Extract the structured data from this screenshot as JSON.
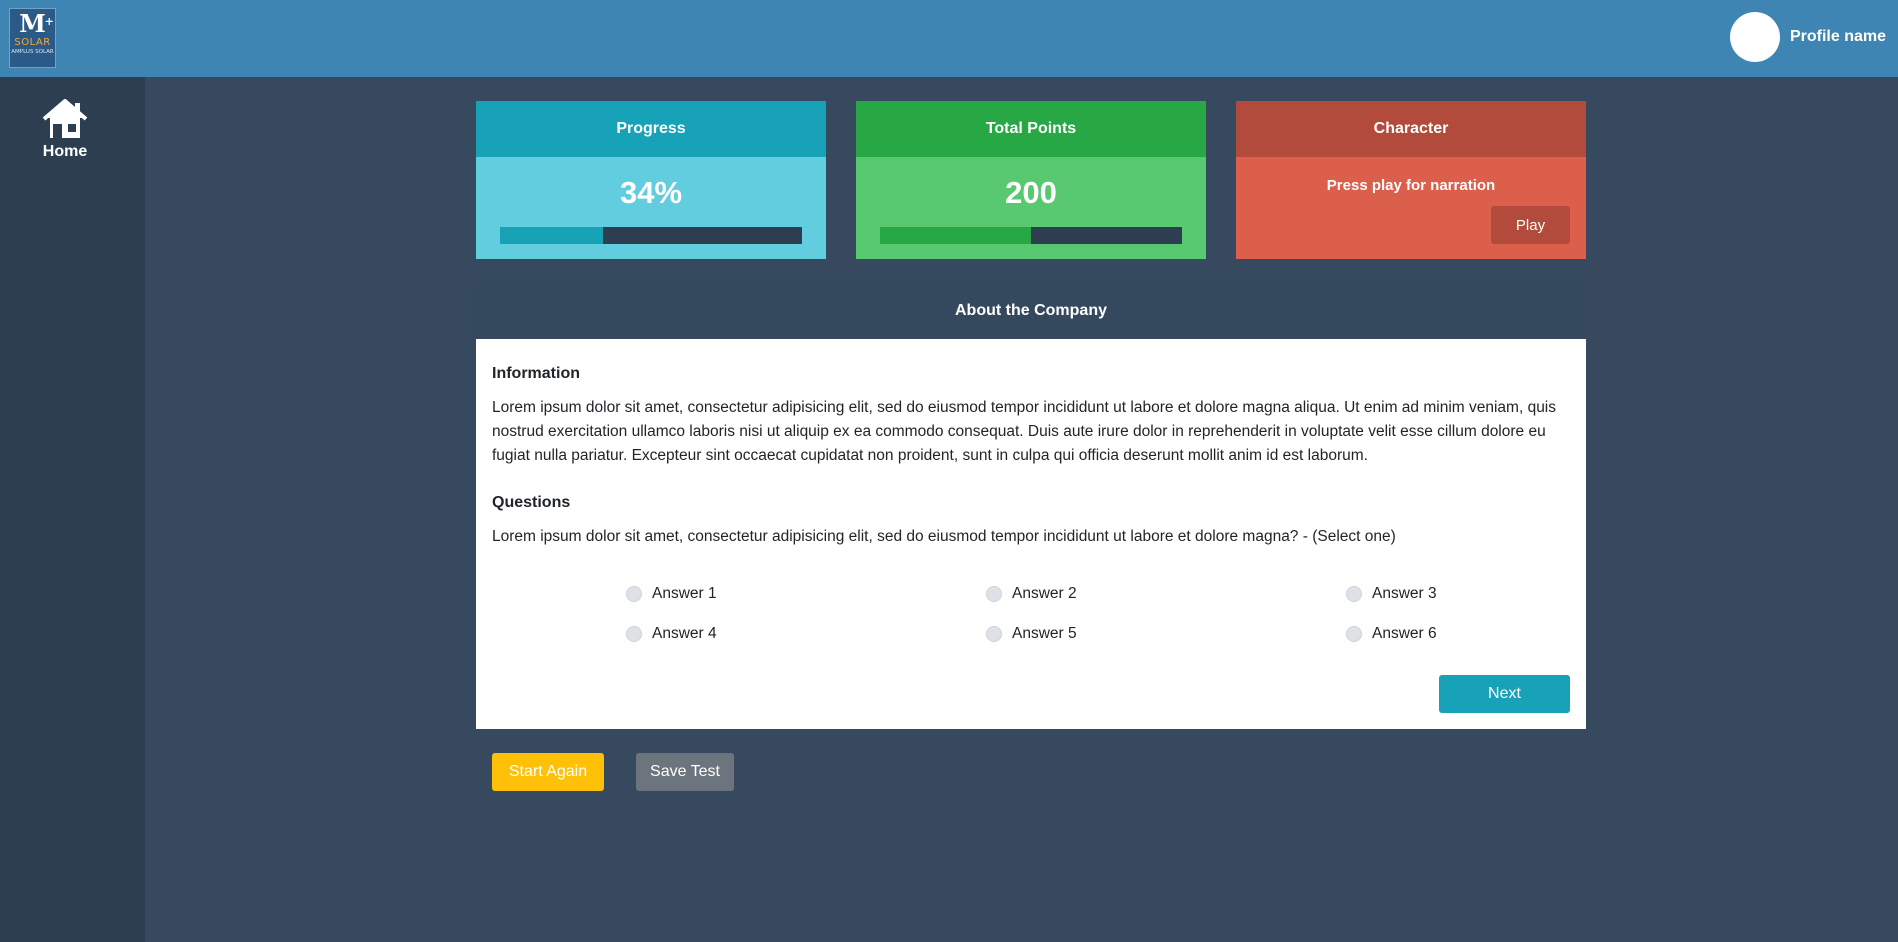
{
  "header": {
    "logo": {
      "mark": "M",
      "superscript": "+",
      "word": "SOLAR",
      "tagline": "AMPLUS SOLAR"
    },
    "profile_name": "Profile name"
  },
  "sidebar": {
    "items": [
      {
        "label": "Home",
        "icon": "home-icon"
      }
    ]
  },
  "cards": {
    "progress": {
      "title": "Progress",
      "value": "34%",
      "fraction": 0.34
    },
    "points": {
      "title": "Total Points",
      "value": "200",
      "fraction": 0.5
    },
    "character": {
      "title": "Character",
      "text": "Press play for narration",
      "play_label": "Play"
    }
  },
  "panel": {
    "title": "About the Company",
    "info_title": "Information",
    "info_text": "Lorem ipsum dolor sit amet, consectetur adipisicing elit, sed do eiusmod tempor incididunt ut labore et dolore magna aliqua. Ut enim ad minim veniam, quis nostrud exercitation ullamco laboris nisi ut aliquip ex ea commodo consequat. Duis aute irure dolor in reprehenderit in voluptate velit esse cillum dolore eu fugiat nulla pariatur. Excepteur sint occaecat cupidatat non proident, sunt in culpa qui officia deserunt mollit anim id est laborum.",
    "questions_title": "Questions",
    "question_text": "Lorem ipsum dolor sit amet, consectetur adipisicing elit, sed do eiusmod tempor incididunt ut labore et dolore magna? - (Select one)",
    "answers": [
      "Answer 1",
      "Answer 2",
      "Answer 3",
      "Answer 4",
      "Answer 5",
      "Answer 6"
    ],
    "next_label": "Next"
  },
  "actions": {
    "start_again_label": "Start Again",
    "save_test_label": "Save Test"
  },
  "colors": {
    "header": "#3e85b4",
    "sidebar": "#2c3e50",
    "background": "#36495f",
    "progress": "#17a2b8",
    "points": "#28a745",
    "character": "#b24b3b",
    "warning": "#ffc107",
    "secondary": "#6c757d"
  }
}
